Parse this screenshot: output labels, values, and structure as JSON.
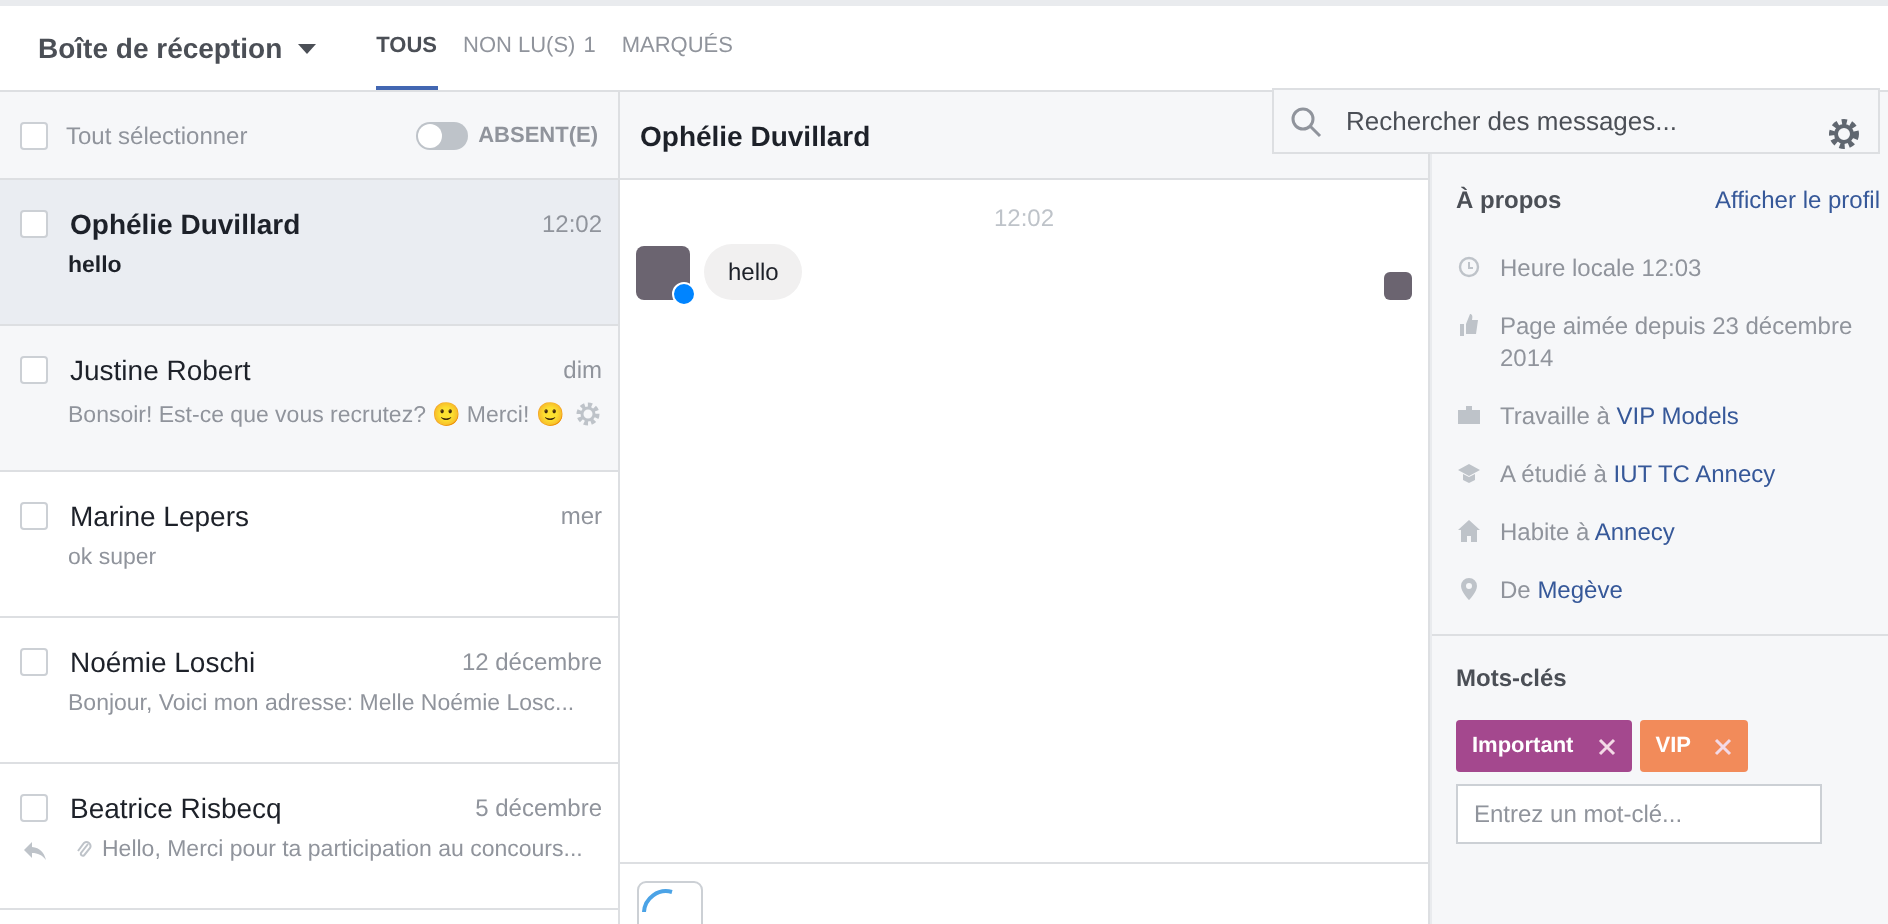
{
  "inbox": {
    "title": "Boîte de réception",
    "tabs": [
      {
        "label": "TOUS",
        "selected": true
      },
      {
        "label": "NON LU(S)",
        "count": "1",
        "selected": false
      },
      {
        "label": "MARQUÉS",
        "selected": false
      }
    ],
    "select_all": {
      "label": "Tout sélectionner",
      "checked": false
    },
    "away": {
      "label": "ABSENT(E)",
      "on": false
    }
  },
  "conversations": [
    {
      "name": "Ophélie Duvillard",
      "time": "12:02",
      "preview": "hello",
      "unread": true,
      "selected": true,
      "hovered": false,
      "checked": false,
      "replied": false,
      "attachment": false
    },
    {
      "name": "Justine Robert",
      "time": "dim",
      "preview": "Bonsoir! Est-ce que vous recrutez? 🙂 Merci! 🙂",
      "unread": false,
      "selected": false,
      "hovered": true,
      "checked": false,
      "replied": false,
      "attachment": false
    },
    {
      "name": "Marine Lepers",
      "time": "mer",
      "preview": "ok super",
      "unread": false,
      "selected": false,
      "hovered": false,
      "checked": false,
      "replied": false,
      "attachment": false
    },
    {
      "name": "Noémie Loschi",
      "time": "12 décembre",
      "preview": "Bonjour, Voici mon adresse: Melle Noémie Losc...",
      "unread": false,
      "selected": false,
      "hovered": false,
      "checked": false,
      "replied": false,
      "attachment": false
    },
    {
      "name": "Beatrice Risbecq",
      "time": "5 décembre",
      "preview": "Hello, Merci pour ta participation au concours...",
      "unread": false,
      "selected": false,
      "hovered": false,
      "checked": false,
      "replied": true,
      "attachment": true
    }
  ],
  "chat": {
    "name": "Ophélie Duvillard",
    "search": {
      "placeholder": "Rechercher des messages..."
    },
    "time": "12:02",
    "messages": [
      {
        "text": "hello"
      }
    ]
  },
  "about": {
    "title": "À propos",
    "link": "Afficher le profil",
    "items": [
      {
        "kind": "clock",
        "text": "Heure locale 12:03"
      },
      {
        "kind": "like",
        "text": "Page aimée depuis 23 décembre 2014"
      },
      {
        "kind": "work",
        "text": "Travaille à",
        "link": "VIP Models"
      },
      {
        "kind": "school",
        "text": "A étudié à",
        "link": "IUT TC Annecy"
      },
      {
        "kind": "home",
        "text": "Habite à",
        "link": "Annecy"
      },
      {
        "kind": "pin",
        "text": "De",
        "link": "Megève"
      }
    ]
  },
  "tags": {
    "title": "Mots-clés",
    "items": [
      {
        "label": "Important",
        "color": "#a4488e"
      },
      {
        "label": "VIP",
        "color": "#f28b5a"
      }
    ],
    "placeholder": "Entrez un mot-clé..."
  }
}
